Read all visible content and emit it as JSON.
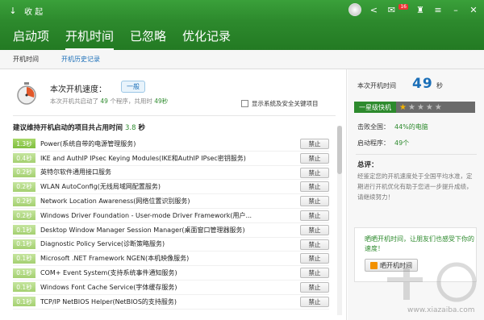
{
  "topbar": {
    "collapse_label": "收 起",
    "notification_count": "16"
  },
  "tabs": [
    "启动项",
    "开机时间",
    "已忽略",
    "优化记录"
  ],
  "subtabs": [
    "开机时间",
    "开机历史记录"
  ],
  "speed": {
    "title": "本次开机速度：",
    "badge": "一般",
    "sub_prefix": "本次开机共启动了",
    "program_count": "49",
    "sub_mid": "个程序，共用时",
    "duration": "49秒",
    "show_system_label": "显示系统及安全关键项目"
  },
  "list": {
    "heading": "建议维持开机启动的项目共占用时间",
    "heading_value": "3.8",
    "heading_unit": "秒",
    "ban_label": "禁止",
    "rows": [
      {
        "time": "1.3秒",
        "name": "Power(系统自带的电源管理服务)"
      },
      {
        "time": "0.4秒",
        "name": "IKE and AuthIP IPsec Keying Modules(IKE和AuthIP IPsec密钥服务)"
      },
      {
        "time": "0.2秒",
        "name": "英特尔软件通用接口服务"
      },
      {
        "time": "0.2秒",
        "name": "WLAN AutoConfig(无线局域网配置服务)"
      },
      {
        "time": "0.2秒",
        "name": "Network Location Awareness(网络位置识别服务)"
      },
      {
        "time": "0.2秒",
        "name": "Windows Driver Foundation - User-mode Driver Framework(用户..."
      },
      {
        "time": "0.1秒",
        "name": "Desktop Window Manager Session Manager(桌面窗口管理器服务)"
      },
      {
        "time": "0.1秒",
        "name": "Diagnostic Policy Service(诊断策略服务)"
      },
      {
        "time": "0.1秒",
        "name": "Microsoft .NET Framework NGEN(本机映像服务)"
      },
      {
        "time": "0.1秒",
        "name": "COM+ Event System(支持系统事件通知服务)"
      },
      {
        "time": "0.1秒",
        "name": "Windows Font Cache Service(字体缓存服务)"
      },
      {
        "time": "0.1秒",
        "name": "TCP/IP NetBIOS Helper(NetBIOS的支持服务)"
      }
    ]
  },
  "right": {
    "this_boot_label": "本次开机时间",
    "this_boot_value": "49",
    "this_boot_unit": "秒",
    "rank_label": "一星级快机",
    "rating": 1,
    "beat_label": "击败全国：",
    "beat_value": "44%的电脑",
    "startup_label": "启动程序：",
    "startup_value": "49个",
    "summary_heading": "总评：",
    "summary_text": "经鉴定您的开机速度处于全国平均水准，定期进行开机优化有助于您进一步提升成绩，请继续努力！",
    "share_text": "晒晒开机时间，让朋友们也感受下你的速度！",
    "share_button": "晒开机时间"
  },
  "watermark": {
    "url": "www.xiazaiba.com"
  },
  "colors": {
    "brand_green": "#2d8a2d",
    "accent_blue": "#1b6fb8",
    "time_tag_green": "#7fbf3f"
  }
}
